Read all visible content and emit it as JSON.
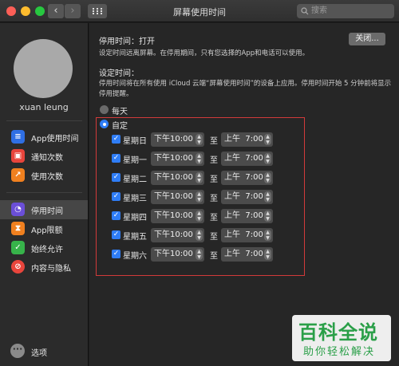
{
  "window": {
    "title": "屏幕使用时间",
    "search_placeholder": "搜索"
  },
  "user": {
    "name": "xuan leung"
  },
  "sidebar": {
    "items": [
      {
        "label": "App使用时间",
        "icon": "app-usage-icon",
        "color": "#2f6fe4"
      },
      {
        "label": "通知次数",
        "icon": "notifications-icon",
        "color": "#e8453c"
      },
      {
        "label": "使用次数",
        "icon": "pickups-icon",
        "color": "#f0801f"
      },
      {
        "label": "停用时间",
        "icon": "downtime-icon",
        "color": "#6b4fd8"
      },
      {
        "label": "App限额",
        "icon": "app-limits-icon",
        "color": "#f0801f"
      },
      {
        "label": "始终允许",
        "icon": "always-allowed-icon",
        "color": "#37b34a"
      },
      {
        "label": "内容与隐私",
        "icon": "content-privacy-icon",
        "color": "#e8453c"
      }
    ],
    "options_label": "选项"
  },
  "main": {
    "downtime_title": "停用时间：",
    "downtime_status": "打开",
    "close_button": "关闭...",
    "downtime_desc": "设定时间远离屏幕。在停用期间，只有您选择的App和电话可以使用。",
    "schedule_title": "设定时间：",
    "schedule_desc_1": "停用时间将在所有使用 iCloud 云端“屏幕使用时间”的设备上应用。停用时间开始 5 分钟前将显示",
    "schedule_desc_2": "停用提醒。",
    "option_every_day": "每天",
    "option_custom": "自定",
    "to_label": "至",
    "days": [
      {
        "name": "星期日",
        "checked": true,
        "start": "下午10:00",
        "end_period": "上午",
        "end_time": "7:00"
      },
      {
        "name": "星期一",
        "checked": true,
        "start": "下午10:00",
        "end_period": "上午",
        "end_time": "7:00"
      },
      {
        "name": "星期二",
        "checked": true,
        "start": "下午10:00",
        "end_period": "上午",
        "end_time": "7:00"
      },
      {
        "name": "星期三",
        "checked": true,
        "start": "下午10:00",
        "end_period": "上午",
        "end_time": "7:00"
      },
      {
        "name": "星期四",
        "checked": true,
        "start": "下午10:00",
        "end_period": "上午",
        "end_time": "7:00"
      },
      {
        "name": "星期五",
        "checked": true,
        "start": "下午10:00",
        "end_period": "上午",
        "end_time": "7:00"
      },
      {
        "name": "星期六",
        "checked": true,
        "start": "下午10:00",
        "end_period": "上午",
        "end_time": "7:00"
      }
    ]
  },
  "watermark": {
    "line1": "百科全说",
    "line2": "助你轻松解决"
  }
}
